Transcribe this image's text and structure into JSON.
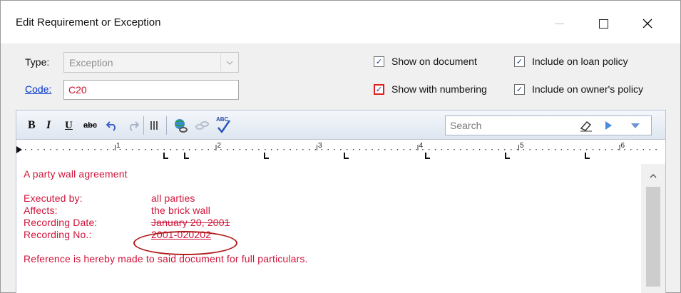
{
  "window": {
    "title": "Edit Requirement or Exception"
  },
  "form": {
    "type_label": "Type:",
    "type_value": "Exception",
    "code_label": "Code:",
    "code_value": "C20"
  },
  "options": {
    "show_on_document": {
      "label": "Show on document",
      "checked": true
    },
    "show_with_numbering": {
      "label": "Show with numbering",
      "checked": true
    },
    "include_on_loan_policy": {
      "label": "Include on loan policy",
      "checked": true
    },
    "include_on_owners_policy": {
      "label": "Include on owner's policy",
      "checked": true
    }
  },
  "toolbar": {
    "bold": "B",
    "italic": "I",
    "underline": "U",
    "strikethrough": "abc",
    "spell": "ABC",
    "search_placeholder": "Search"
  },
  "ruler": {
    "numbers": [
      "1",
      "2",
      "3",
      "4",
      "5",
      "6"
    ]
  },
  "document": {
    "heading": "A party wall agreement",
    "fields": [
      {
        "label": "Executed by:",
        "value": "all parties"
      },
      {
        "label": "Affects:",
        "value": "the brick wall"
      },
      {
        "label": "Recording Date:",
        "value": "January 20, 2001"
      },
      {
        "label": "Recording No.:",
        "value": "2001-020202"
      }
    ],
    "footer": "Reference is hereby made to said document for full particulars."
  },
  "colors": {
    "document_text": "#d0143a",
    "annotation_circle": "#b01b1b",
    "link": "#0033cc",
    "checkbox_highlight": "#e02020"
  }
}
